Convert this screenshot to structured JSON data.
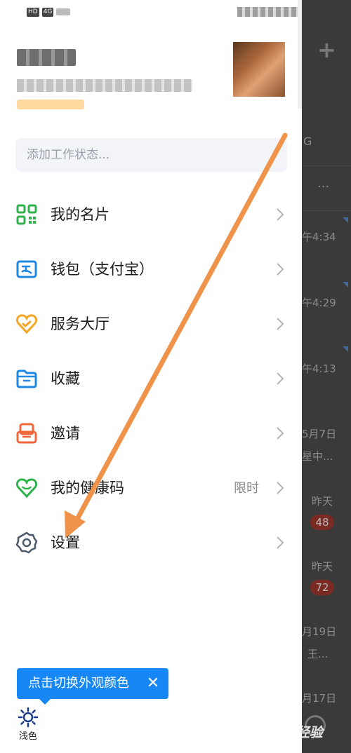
{
  "status_bar": {
    "network": "4G"
  },
  "status_input": {
    "placeholder": "添加工作状态..."
  },
  "menu": [
    {
      "label": "我的名片",
      "icon": "qr-card-icon",
      "extra": ""
    },
    {
      "label": "钱包（支付宝）",
      "icon": "wallet-icon",
      "extra": ""
    },
    {
      "label": "服务大厅",
      "icon": "service-heart-icon",
      "extra": ""
    },
    {
      "label": "收藏",
      "icon": "folder-icon",
      "extra": ""
    },
    {
      "label": "邀请",
      "icon": "invite-icon",
      "extra": ""
    },
    {
      "label": "我的健康码",
      "icon": "health-code-icon",
      "extra": "限时"
    },
    {
      "label": "设置",
      "icon": "gear-icon",
      "extra": ""
    }
  ],
  "theme_tooltip": {
    "text": "点击切换外观颜色",
    "close": "✕"
  },
  "theme_toggle": {
    "label": "浅色"
  },
  "background_app": {
    "header_fragment": "G",
    "times": [
      "午4:34",
      "午4:29",
      "午4:13",
      "5月7日",
      "昨天",
      "昨天",
      "月19日",
      "月17日"
    ],
    "snippets": [
      "星中...",
      "王..."
    ],
    "badges": [
      "48",
      "72"
    ],
    "watermark": "Bai经验"
  },
  "colors": {
    "accent": "#1687f5",
    "arrow": "#f0934a",
    "qr": "#2db34a",
    "wallet": "#1e88e5",
    "service": "#f5a623",
    "folder": "#1e88e5",
    "invite": "#f0663a",
    "health": "#2db34a",
    "gear": "#4a5a6a"
  }
}
